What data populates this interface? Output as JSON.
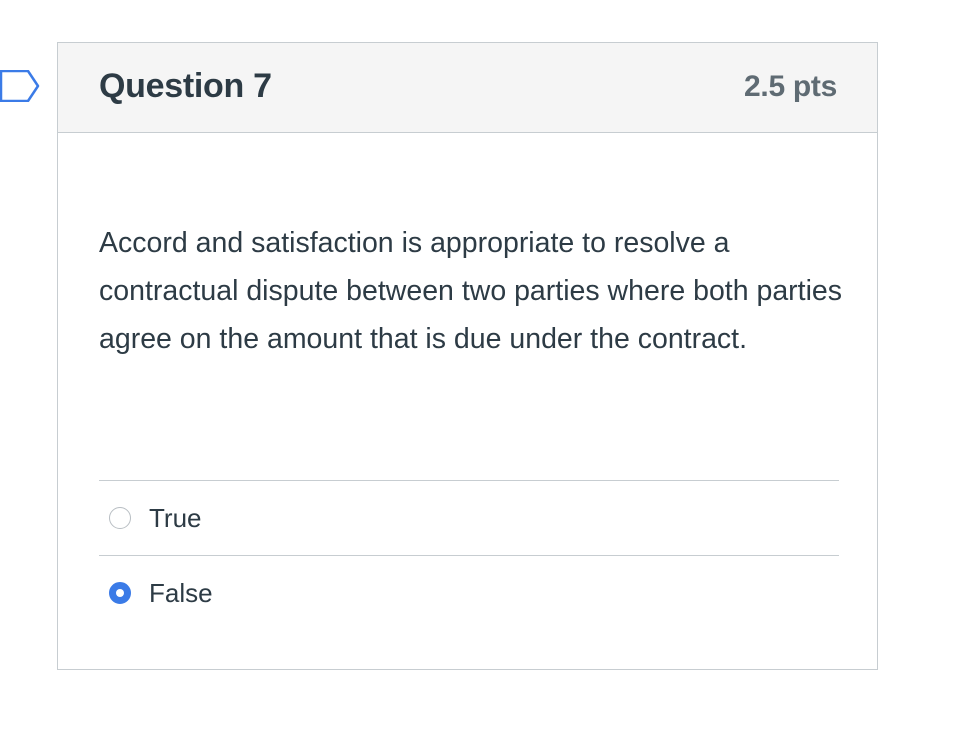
{
  "question": {
    "title": "Question 7",
    "points": "2.5 pts",
    "text": "Accord and satisfaction is appropriate to resolve a contractual dispute between two parties where both parties agree on the amount that is due under the contract.",
    "flag_icon": "flag-outline-icon"
  },
  "answers": [
    {
      "label": "True",
      "selected": false
    },
    {
      "label": "False",
      "selected": true
    }
  ],
  "colors": {
    "accent": "#3b7be7",
    "border": "#c7cdd1",
    "header_bg": "#f5f5f5",
    "text": "#2d3b45"
  }
}
